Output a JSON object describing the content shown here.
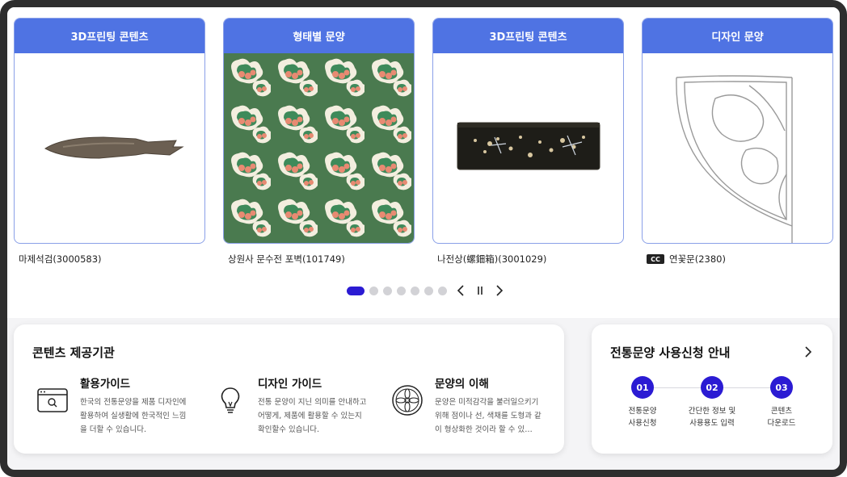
{
  "cards": [
    {
      "header": "3D프린팅 콘텐츠",
      "caption": "마제석검(3000583)"
    },
    {
      "header": "형태별 문양",
      "caption": "상원사 문수전 포벽(101749)"
    },
    {
      "header": "3D프린팅 콘텐츠",
      "caption": "나전상(螺鈿箱)(3001029)"
    },
    {
      "header": "디자인 문양",
      "caption": "연꽃문(2380)",
      "badge": "CC"
    }
  ],
  "pager": {
    "total_dots": 7,
    "active_index": 0,
    "prev_icon": "chevron-left-icon",
    "pause_icon": "pause-icon",
    "next_icon": "chevron-right-icon"
  },
  "provider_panel": {
    "title": "콘텐츠 제공기관",
    "guides": [
      {
        "title": "활용가이드",
        "desc": "한국의 전통문양을 제품 디자인에 활용하여 실생활에 한국적인 느낌을 더할 수 있습니다.",
        "icon": "browser-search-icon"
      },
      {
        "title": "디자인 가이드",
        "desc": "전통 문양이 지닌 의미를 안내하고 어떻게, 제품에 활용할 수 있는지 확인할수 있습니다.",
        "icon": "lightbulb-icon"
      },
      {
        "title": "문양의 이해",
        "desc": "문양은 미적감각을 불러일으키기 위해 점이나 선, 색채를 도형과 같이 형상화한 것이라 할 수 있…",
        "icon": "pattern-medallion-icon"
      }
    ]
  },
  "application_panel": {
    "title": "전통문양 사용신청 안내",
    "steps": [
      {
        "num": "01",
        "label_1": "전통문양",
        "label_2": "사용신청"
      },
      {
        "num": "02",
        "label_1": "간단한 정보 및",
        "label_2": "사용용도 입력"
      },
      {
        "num": "03",
        "label_1": "콘텐츠",
        "label_2": "다운로드"
      }
    ]
  },
  "colors": {
    "header_blue": "#4f73e3",
    "accent": "#2b1bd3",
    "card_border": "#8aa0e8",
    "pattern_green": "#4a7a4f"
  }
}
